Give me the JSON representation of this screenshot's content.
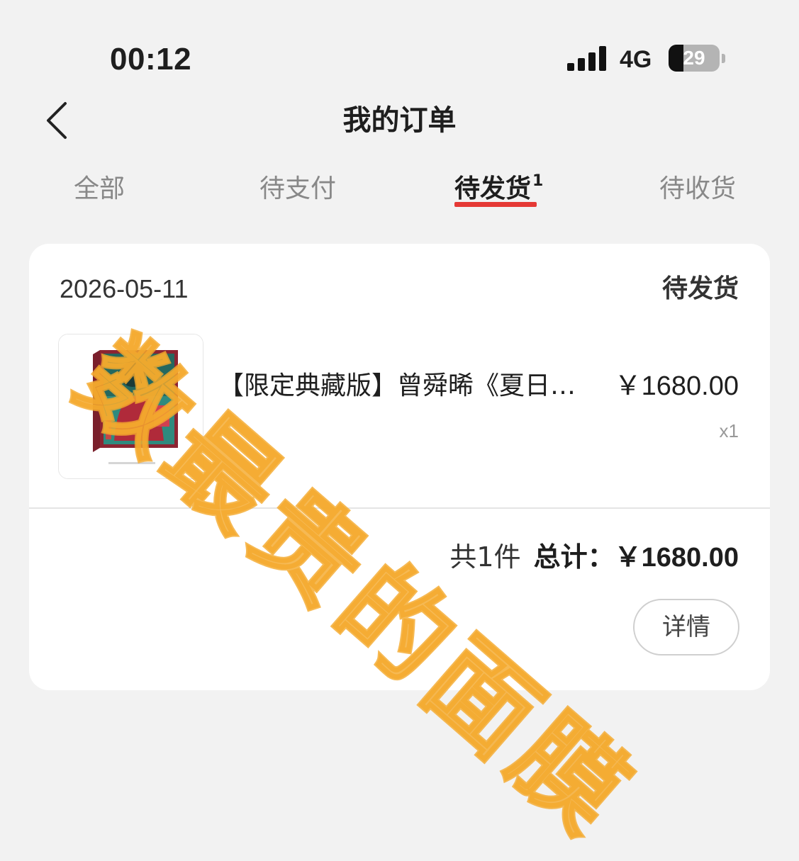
{
  "status_bar": {
    "time": "00:12",
    "network": "4G",
    "battery_level": 29,
    "battery_text": "29"
  },
  "header": {
    "title": "我的订单",
    "back_icon": "chevron-left-icon"
  },
  "tabs": [
    {
      "label": "全部",
      "active": false
    },
    {
      "label": "待支付",
      "active": false
    },
    {
      "label": "待发货",
      "active": true,
      "badge": "1"
    },
    {
      "label": "待收货",
      "active": false
    }
  ],
  "colors": {
    "accent": "#e53935",
    "watermark": "#f4aa2d",
    "background": "#f2f2f2"
  },
  "order": {
    "date": "2026-05-11",
    "status": "待发货",
    "product": {
      "name": "【限定典藏版】曾舜晞《夏日限定》",
      "price": "￥1680.00",
      "quantity": "x1"
    },
    "summary": {
      "count": "共1件",
      "total_label": "总计：",
      "total_value": "￥1680.00"
    },
    "detail_button": "详情"
  },
  "watermark": "数最贵的面膜"
}
